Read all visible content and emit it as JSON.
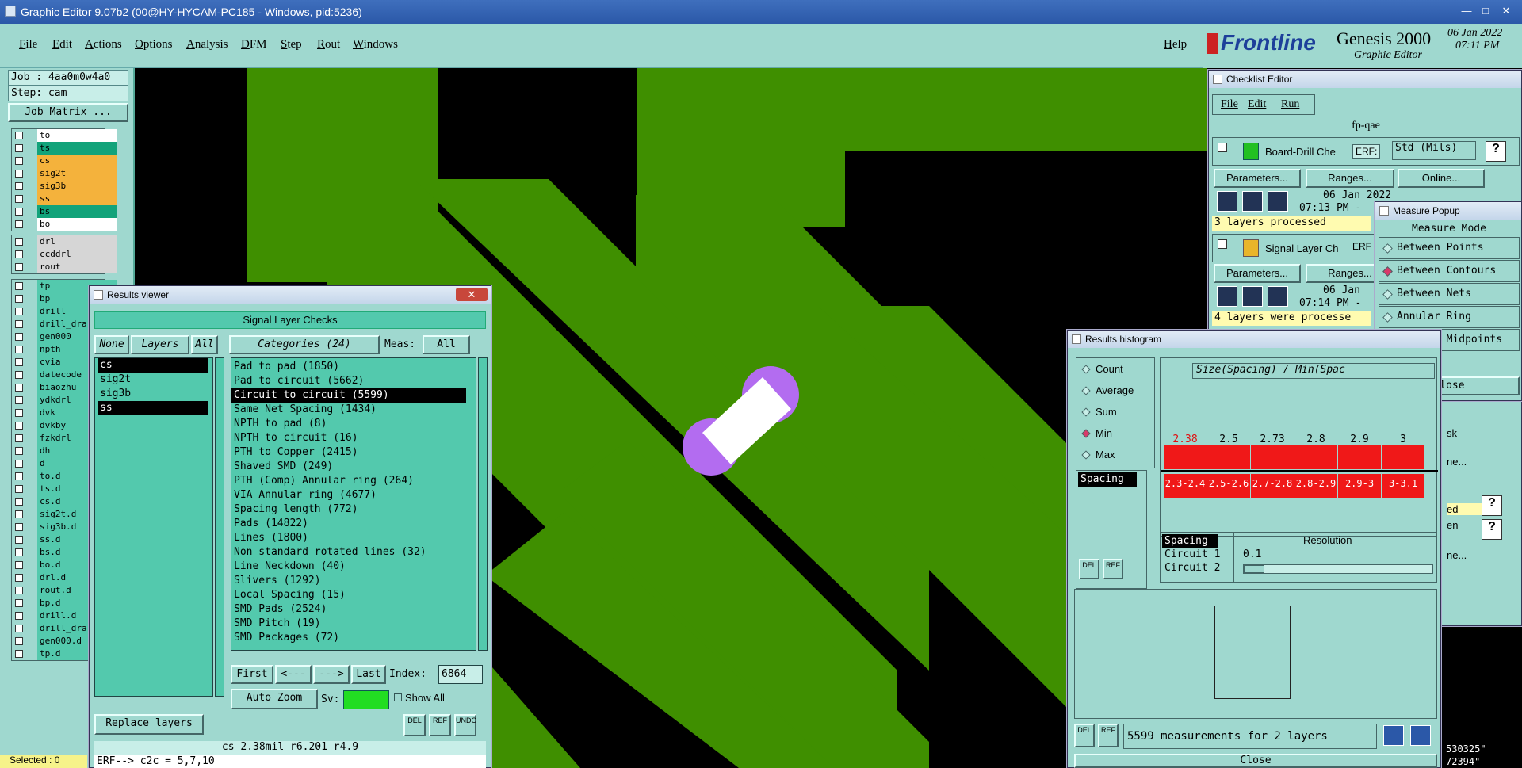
{
  "app": {
    "title": "Graphic Editor 9.07b2 (00@HY-HYCAM-PC185 - Windows, pid:5236)"
  },
  "menu": [
    "File",
    "Edit",
    "Actions",
    "Options",
    "Analysis",
    "DFM",
    "Step",
    "Rout",
    "Windows"
  ],
  "help": "Help",
  "logo": {
    "brand": "Frontline",
    "product": "Genesis 2000",
    "subtitle": "Graphic Editor",
    "date": "06 Jan 2022",
    "time": "07:11 PM"
  },
  "job": {
    "job": "Job : 4aa0m0w4a0",
    "step": "Step: cam",
    "matrix": "Job Matrix ..."
  },
  "layers_top": [
    "to",
    "ts",
    "cs",
    "sig2t",
    "sig3b",
    "ss",
    "bs",
    "bo"
  ],
  "layers_mid": [
    "drl",
    "ccddrl",
    "rout"
  ],
  "layers_bottom": [
    "tp",
    "bp",
    "drill",
    "drill_dra",
    "gen000",
    "npth",
    "cvia",
    "datecode",
    "biaozhu",
    "ydkdrl",
    "dvk",
    "dvkby",
    "fzkdrl",
    "dh",
    "d",
    "to.d",
    "ts.d",
    "cs.d",
    "sig2t.d",
    "sig3b.d",
    "ss.d",
    "bs.d",
    "bo.d",
    "drl.d",
    "rout.d",
    "bp.d",
    "drill.d",
    "drill_dra",
    "gen000.d",
    "tp.d"
  ],
  "selected": "Selected : 0",
  "results_viewer": {
    "title": "Results viewer",
    "header": "Signal Layer Checks",
    "none": "None",
    "layers": "Layers",
    "all": "All",
    "categories_label": "Categories (24)",
    "meas_label": "Meas:",
    "meas_value": "All",
    "layer_list": [
      "cs",
      "sig2t",
      "sig3b",
      "ss"
    ],
    "categories": [
      "Pad to pad (1850)",
      "Pad to circuit (5662)",
      "Circuit to circuit (5599)",
      "Same Net Spacing (1434)",
      "NPTH to pad (8)",
      "NPTH to circuit (16)",
      "PTH to Copper (2415)",
      "Shaved SMD (249)",
      "PTH (Comp) Annular ring (264)",
      "VIA Annular ring (4677)",
      "Spacing length (772)",
      "Pads (14822)",
      "Lines (1800)",
      "Non standard rotated lines (32)",
      "Line Neckdown (40)",
      "Slivers (1292)",
      "Local Spacing (15)",
      "SMD Pads (2524)",
      "SMD Pitch (19)",
      "SMD Packages (72)"
    ],
    "first": "First",
    "prev": "<---",
    "next": "--->",
    "last": "Last",
    "index_label": "Index:",
    "index_value": "6864",
    "auto_zoom": "Auto Zoom",
    "sv": "Sv:",
    "show_all": "Show All",
    "replace_layers": "Replace layers",
    "del": "DEL",
    "ref": "REF",
    "undo": "UNDO",
    "status": "cs 2.38mil   r6.201   r4.9",
    "erf": "ERF--> c2c = 5,7,10"
  },
  "checklist": {
    "title": "Checklist Editor",
    "menu": [
      "File",
      "Edit",
      "Run"
    ],
    "name": "fp-qae",
    "row1": {
      "name": "Board-Drill Che",
      "erf": "ERF:",
      "erf_value": "Std (Mils)",
      "q": "?"
    },
    "params": "Parameters...",
    "ranges": "Ranges...",
    "online": "Online...",
    "date1": "06 Jan 2022",
    "time1": "07:13 PM -",
    "proc1": "3 layers processed",
    "row2": {
      "name": "Signal Layer Ch",
      "erf": "ERF"
    },
    "date2": "06 Jan",
    "time2": "07:14 PM -",
    "proc2": "4 layers were processe",
    "side_labels": [
      "sk",
      "ne...",
      "ed",
      "en",
      "ne..."
    ]
  },
  "measure": {
    "title": "Measure Popup",
    "mode": "Measure Mode",
    "options": [
      "Between Points",
      "Between Contours",
      "Between Nets",
      "Annular Ring",
      "Between Midpoints"
    ],
    "selected_index": 1,
    "close": "Close"
  },
  "histogram": {
    "title": "Results histogram",
    "stats": [
      "Count",
      "Average",
      "Sum",
      "Min",
      "Max"
    ],
    "stat_selected": 3,
    "spacing": "Spacing",
    "heading": "Size(Spacing) / Min(Spac",
    "values": [
      "2.38",
      "2.5",
      "2.73",
      "2.8",
      "2.9",
      "3"
    ],
    "ranges": [
      "2.3-2.4",
      "2.5-2.6",
      "2.7-2.8",
      "2.8-2.9",
      "2.9-3",
      "3-3.1"
    ],
    "fields": [
      "Spacing",
      "Circuit 1",
      "Circuit 2"
    ],
    "resolution": "Resolution",
    "res_value": "0.1",
    "summary": "5599 measurements for 2 layers",
    "del": "DEL",
    "ref": "REF",
    "close": "Close",
    "coords": [
      "530325\"",
      "72394\""
    ]
  },
  "colors": {
    "copper": "#3f8f00",
    "bg": "#000000",
    "panel": "#9fd8cf",
    "list": "#53c9ad",
    "highlight_violet": "#b36cf0",
    "bar": "#f01818"
  }
}
